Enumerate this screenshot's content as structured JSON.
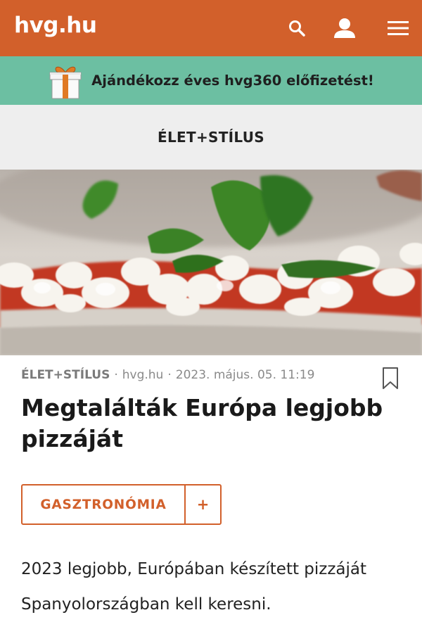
{
  "header": {
    "logo": "hvg.hu",
    "icons": [
      "search-icon",
      "user-icon",
      "menu-icon"
    ],
    "color": "#d2602b"
  },
  "promo": {
    "text": "Ajándékozz éves hvg360 előfizetést!",
    "icon": "gift-icon",
    "color": "#6cbfa2"
  },
  "section": {
    "title": "ÉLET+STÍLUS"
  },
  "article": {
    "category": "ÉLET+STÍLUS",
    "source": "hvg.hu",
    "date": "2023. május. 05. 11:19",
    "title": "Megtalálták Európa legjobb pizzáját",
    "tag": "GASZTRONÓMIA",
    "tag_add": "+",
    "lead": "2023 legjobb, Európában készített pizzáját Spanyolországban kell keresni."
  }
}
